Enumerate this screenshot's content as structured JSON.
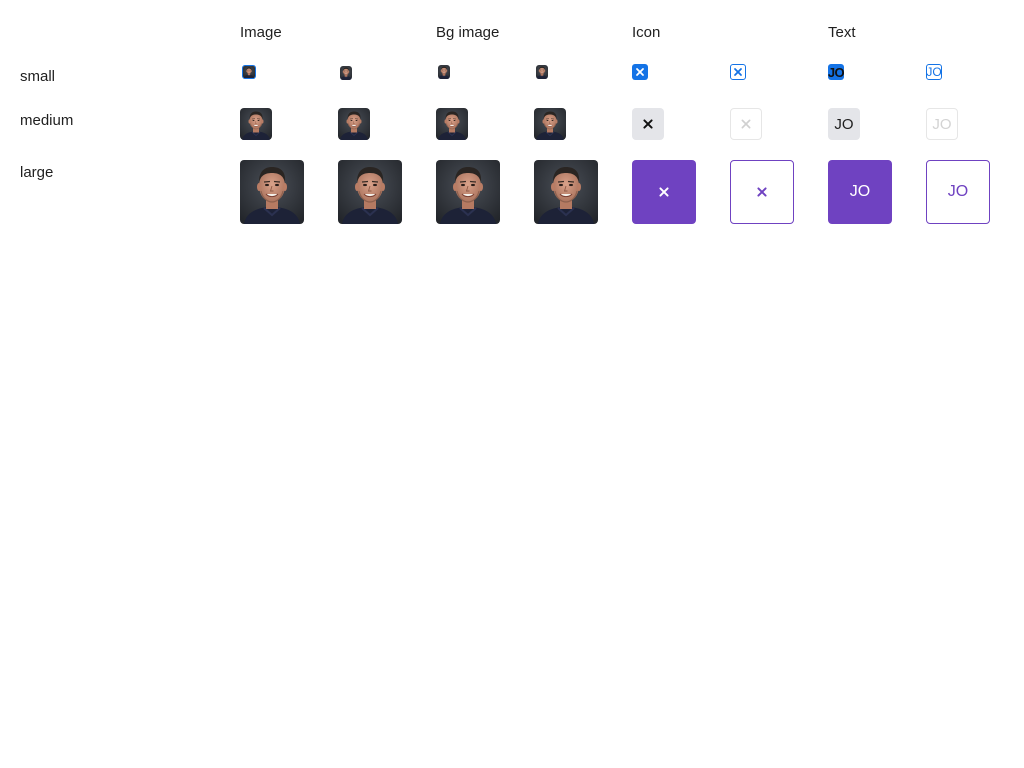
{
  "columns": {
    "image": "Image",
    "bg_image": "Bg image",
    "icon": "Icon",
    "text": "Text"
  },
  "rows": {
    "small": "small",
    "medium": "medium",
    "large": "large"
  },
  "avatar_text": "JO",
  "icon_glyph": "close-icon",
  "colors": {
    "accent_blue": "#1473e6",
    "accent_purple": "#6f42c1",
    "neutral_fill": "#e4e5e9",
    "portrait_bg": "#2f333a"
  }
}
